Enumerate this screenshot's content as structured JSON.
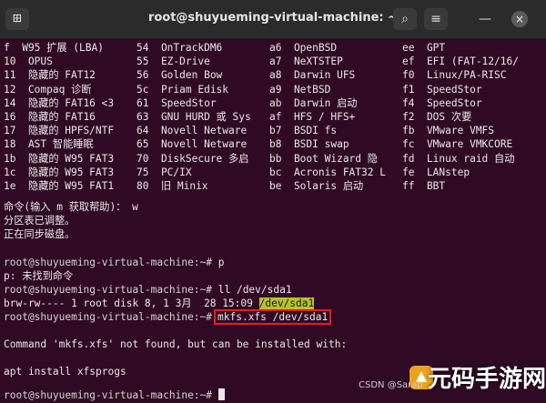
{
  "window": {
    "title": "root@shuyueming-virtual-machine: ~",
    "newtab_icon": "⊞",
    "search_icon": "⌕",
    "menu_icon": "≡",
    "minimize_icon": "—",
    "close_icon": "×"
  },
  "partition_table": [
    [
      "f  W95 扩展 (LBA)",
      "54  OnTrackDM6",
      "a6  OpenBSD",
      "ee  GPT"
    ],
    [
      "10  OPUS",
      "55  EZ-Drive",
      "a7  NeXTSTEP",
      "ef  EFI (FAT-12/16/"
    ],
    [
      "11  隐藏的 FAT12",
      "56  Golden Bow",
      "a8  Darwin UFS",
      "f0  Linux/PA-RISC"
    ],
    [
      "12  Compaq 诊断",
      "5c  Priam Edisk",
      "a9  NetBSD",
      "f1  SpeedStor"
    ],
    [
      "14  隐藏的 FAT16 <3",
      "61  SpeedStor",
      "ab  Darwin 启动",
      "f4  SpeedStor"
    ],
    [
      "16  隐藏的 FAT16",
      "63  GNU HURD 或 Sys",
      "af  HFS / HFS+",
      "f2  DOS 次要"
    ],
    [
      "17  隐藏的 HPFS/NTF",
      "64  Novell Netware",
      "b7  BSDI fs",
      "fb  VMware VMFS"
    ],
    [
      "18  AST 智能睡眠",
      "65  Novell Netware",
      "b8  BSDI swap",
      "fc  VMware VMKCORE"
    ],
    [
      "1b  隐藏的 W95 FAT3",
      "70  DiskSecure 多启",
      "bb  Boot Wizard 隐",
      "fd  Linux raid 自动"
    ],
    [
      "1c  隐藏的 W95 FAT3",
      "75  PC/IX",
      "bc  Acronis FAT32 L",
      "fe  LANstep"
    ],
    [
      "1e  隐藏的 W95 FAT1",
      "80  旧 Minix",
      "be  Solaris 启动",
      "ff  BBT"
    ]
  ],
  "lines": {
    "cmd_help": "命令(输入 m 获取帮助)： w",
    "table_adjusted": "分区表已调整。",
    "syncing": "正在同步磁盘。",
    "prompt": "root@shuyueming-virtual-machine:~#",
    "cmd_p": " p",
    "p_not_found": "p: 未找到命令",
    "cmd_ll": " ll /dev/sda1",
    "ll_output": "brw-rw---- 1 root disk 8, 1 3月  28 15:09 ",
    "ll_dev": "/dev/sda1",
    "cmd_mkfs": "mkfs.xfs /dev/sda1",
    "mkfs_not_found": "Command 'mkfs.xfs' not found, but can be installed with:",
    "apt_install": "apt install xfsprogs"
  },
  "watermark": {
    "csdn": "CSDN @Sarap",
    "logo": "元码手游网"
  },
  "colors": {
    "terminal_bg": "#300a24",
    "titlebar_bg": "#2b2b2b",
    "dev_highlight": "#b6c42a",
    "command_box": "#e02020"
  }
}
